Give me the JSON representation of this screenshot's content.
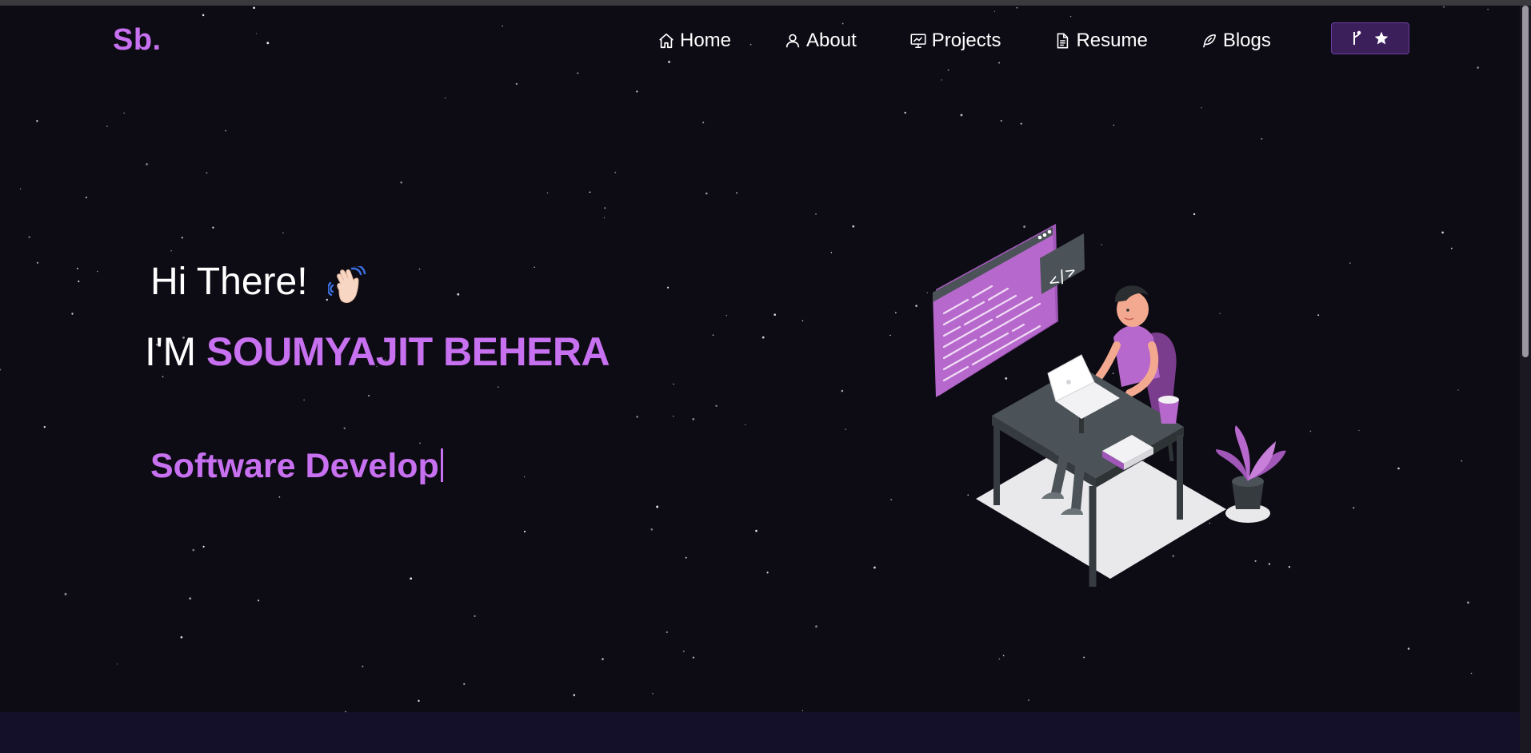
{
  "brand": {
    "logo_text": "Sb.",
    "accent_color": "#c770f0",
    "background_color": "#0d0b14"
  },
  "nav": {
    "items": [
      {
        "label": "Home",
        "icon": "home-icon"
      },
      {
        "label": "About",
        "icon": "user-icon"
      },
      {
        "label": "Projects",
        "icon": "projects-icon"
      },
      {
        "label": "Resume",
        "icon": "document-icon"
      },
      {
        "label": "Blogs",
        "icon": "feather-icon"
      }
    ],
    "fork_button": {
      "icons": [
        "git-fork-icon",
        "star-icon"
      ]
    }
  },
  "hero": {
    "greeting": "Hi There!",
    "greeting_emoji": "waving-hand-icon",
    "intro_prefix": "I'M",
    "name": "SOUMYAJIT BEHERA",
    "typewriter_text": "Software Develop"
  },
  "illustration": {
    "icon": "developer-at-desk-illustration",
    "code_badge": "</>"
  }
}
